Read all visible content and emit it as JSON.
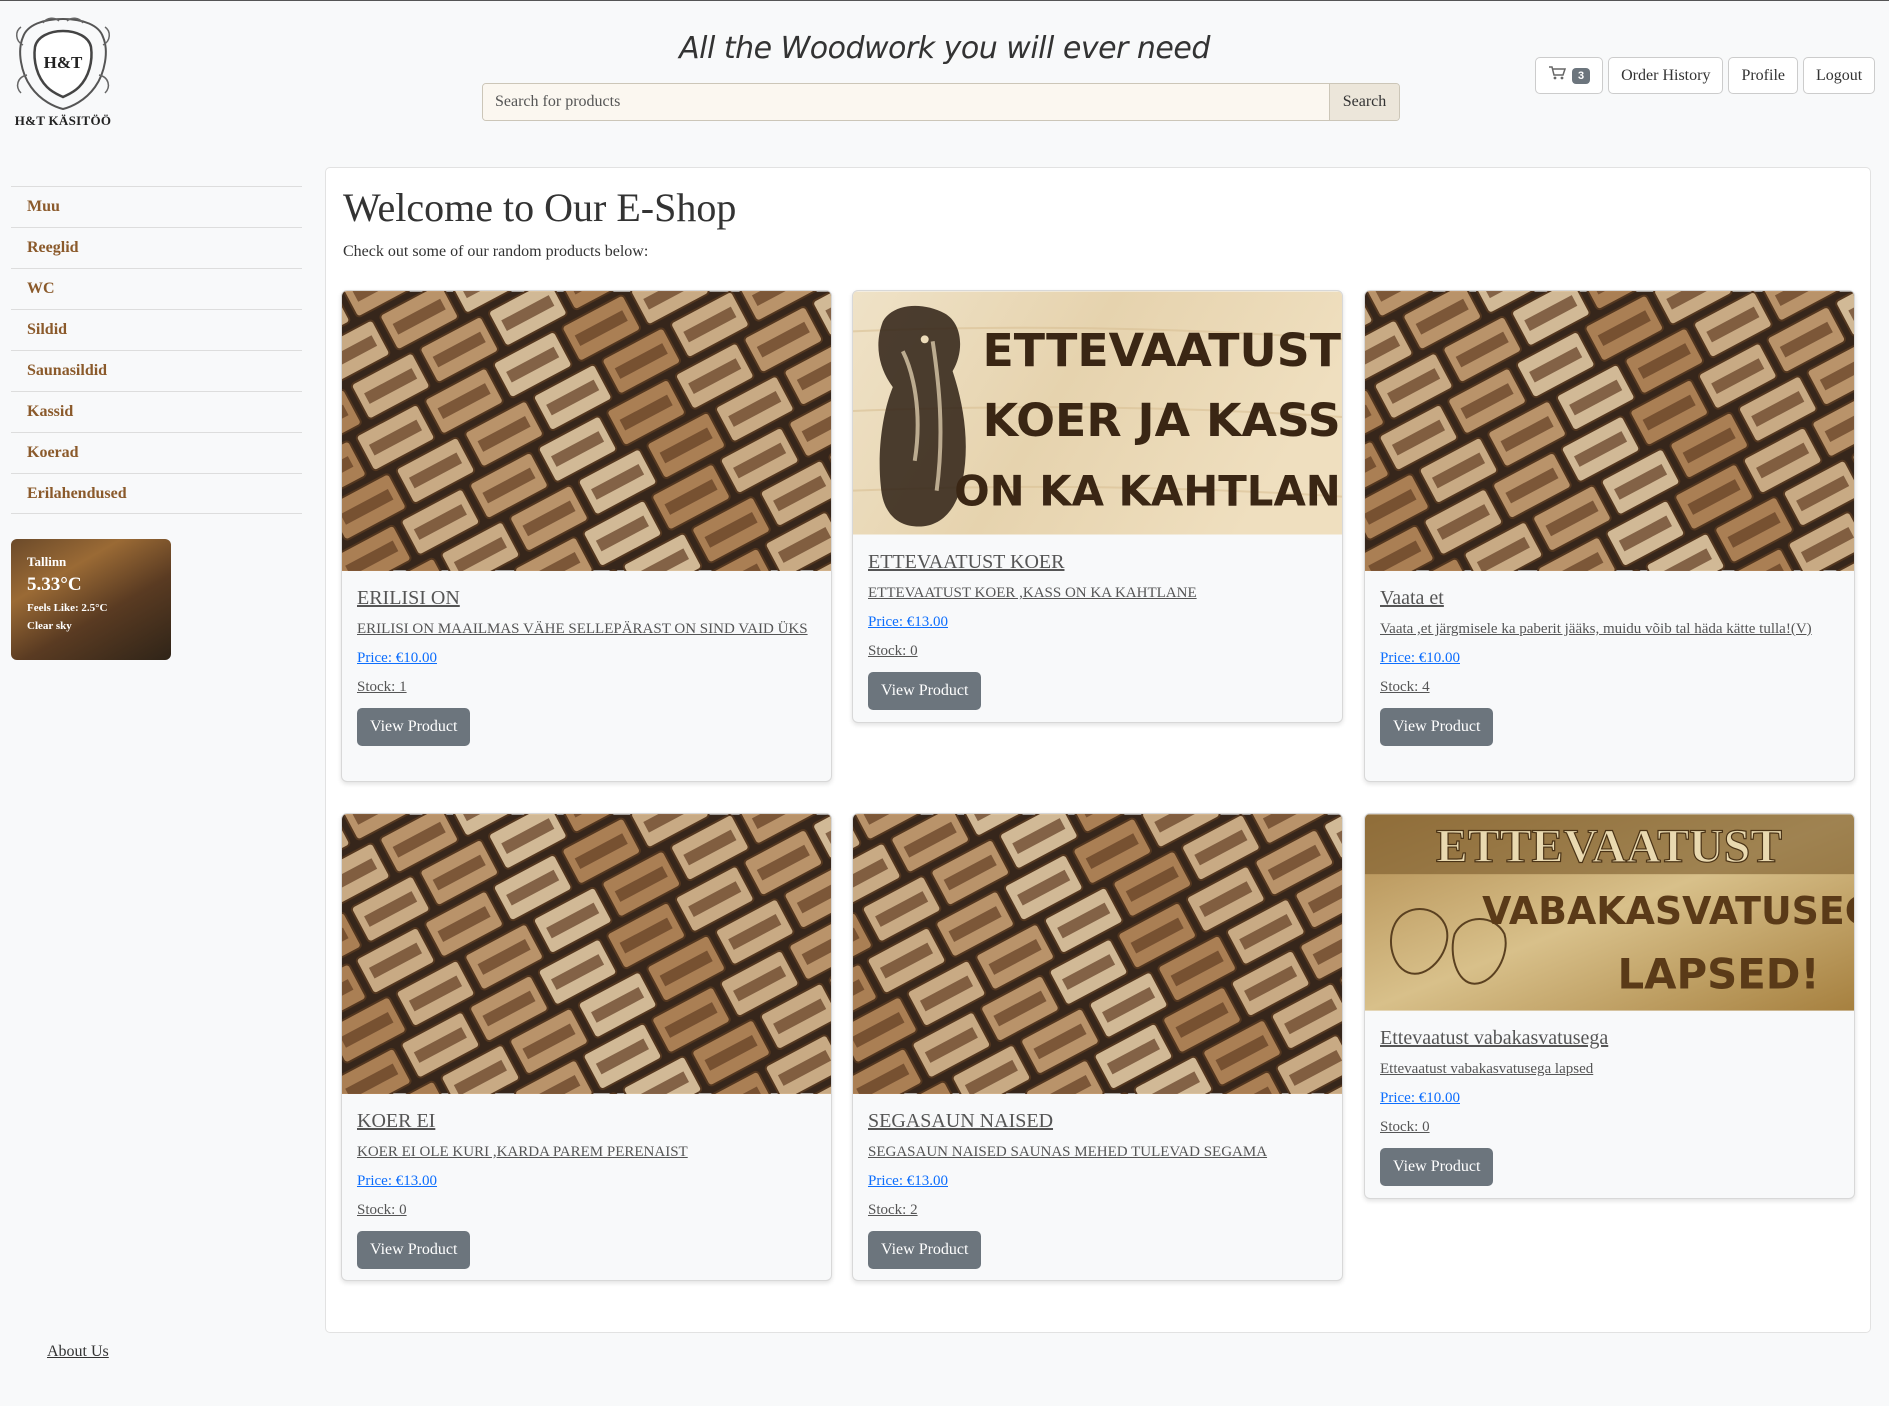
{
  "header": {
    "logo_emblem_text": "H&T",
    "logo_text": "H&T KÄSITÖÖ",
    "tagline": "All the Woodwork you will ever need",
    "search_placeholder": "Search for products",
    "search_button": "Search",
    "cart_count": "3",
    "cart_icon": "shopping-cart-icon",
    "nav": {
      "order_history": "Order History",
      "profile": "Profile",
      "logout": "Logout"
    }
  },
  "sidebar": {
    "items": [
      {
        "label": "Muu"
      },
      {
        "label": "Reeglid"
      },
      {
        "label": "WC"
      },
      {
        "label": "Sildid"
      },
      {
        "label": "Saunasildid"
      },
      {
        "label": "Kassid"
      },
      {
        "label": "Koerad"
      },
      {
        "label": "Erilahendused"
      }
    ],
    "weather": {
      "city": "Tallinn",
      "temp": "5.33°C",
      "feels": "Feels Like: 2.5°C",
      "condition": "Clear sky"
    },
    "about": "About Us"
  },
  "main": {
    "title": "Welcome to Our E-Shop",
    "subtitle": "Check out some of our random products below:",
    "view_button": "View Product",
    "products": [
      {
        "name": "ERILISI ON",
        "desc": "ERILISI ON MAAILMAS VÄHE SELLEPÄRAST ON SIND VAID ÜKS",
        "price": "Price: €10.00",
        "stock": "Stock: 1",
        "image": "business-cards"
      },
      {
        "name": "ETTEVAATUST KOER",
        "desc": "ETTEVAATUST KOER ,KASS ON KA KAHTLANE",
        "price": "Price: €13.00",
        "stock": "Stock: 0",
        "image": "dog-sign",
        "sign_lines": [
          "ETTEVAATUST",
          "KOER JA KASS",
          "ON KA KAHTLANE"
        ]
      },
      {
        "name": "Vaata et",
        "desc": "Vaata ,et järgmisele ka paberit jääks, muidu võib tal häda kätte tulla!(V)",
        "price": "Price: €10.00",
        "stock": "Stock: 4",
        "image": "business-cards"
      },
      {
        "name": "KOER EI",
        "desc": "KOER EI OLE KURI ,KARDA PAREM PERENAIST",
        "price": "Price: €13.00",
        "stock": "Stock: 0",
        "image": "business-cards"
      },
      {
        "name": "SEGASAUN NAISED",
        "desc": "SEGASAUN NAISED SAUNAS MEHED TULEVAD SEGAMA",
        "price": "Price: €13.00",
        "stock": "Stock: 2",
        "image": "business-cards"
      },
      {
        "name": "Ettevaatust vabakasvatusega",
        "desc": "Ettevaatust vabakasvatusega lapsed",
        "price": "Price: €10.00",
        "stock": "Stock: 0",
        "image": "kids-sign",
        "sign_lines": [
          "ETTEVAATUST",
          "VABAKASVATUSEGA",
          "LAPSED!"
        ]
      }
    ]
  },
  "colors": {
    "page_bg": "#f8f9fa",
    "sidebar_link": "#8b5a2b",
    "price_link": "#0d6efd",
    "button_bg": "#6c757d"
  }
}
